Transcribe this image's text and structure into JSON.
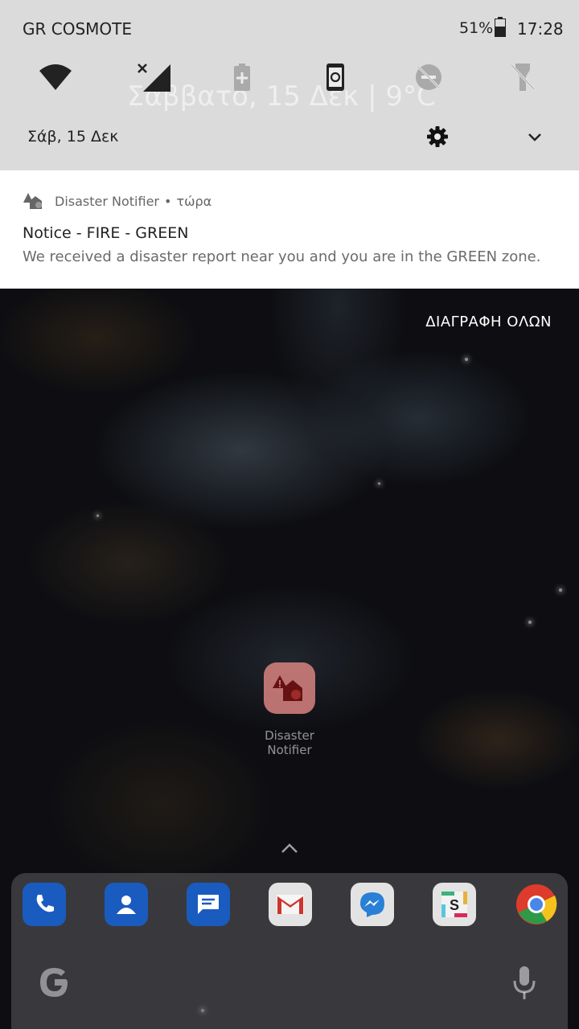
{
  "status_bar": {
    "carrier": "GR COSMOTE",
    "battery_percent": "51%",
    "time": "17:28"
  },
  "quick_settings": {
    "background_text": "Σάββατο, 15 Δεκ  |  9°C",
    "tiles": [
      "wifi-icon",
      "signal-no-data-icon",
      "battery-saver-icon",
      "screen-rotate-icon",
      "do-not-disturb-off-icon",
      "flashlight-off-icon"
    ],
    "date": "Σάβ, 15 Δεκ"
  },
  "notification": {
    "app_name": "Disaster Notifier",
    "time": "τώρα",
    "title": "Notice - FIRE - GREEN",
    "body": "We received a disaster report near you and you are in the GREEN zone."
  },
  "clear_all_label": "ΔΙΑΓΡΑΦΗ ΟΛΩΝ",
  "home": {
    "app_label": "Disaster Notifier"
  },
  "dock": {
    "apps": [
      "phone-icon",
      "contacts-icon",
      "messages-icon",
      "gmail-icon",
      "messenger-icon",
      "slack-icon",
      "chrome-icon"
    ]
  },
  "colors": {
    "shade_bg": "#ebebeb",
    "notification_bg": "#ffffff",
    "app_icon_red": "#e58a86"
  }
}
